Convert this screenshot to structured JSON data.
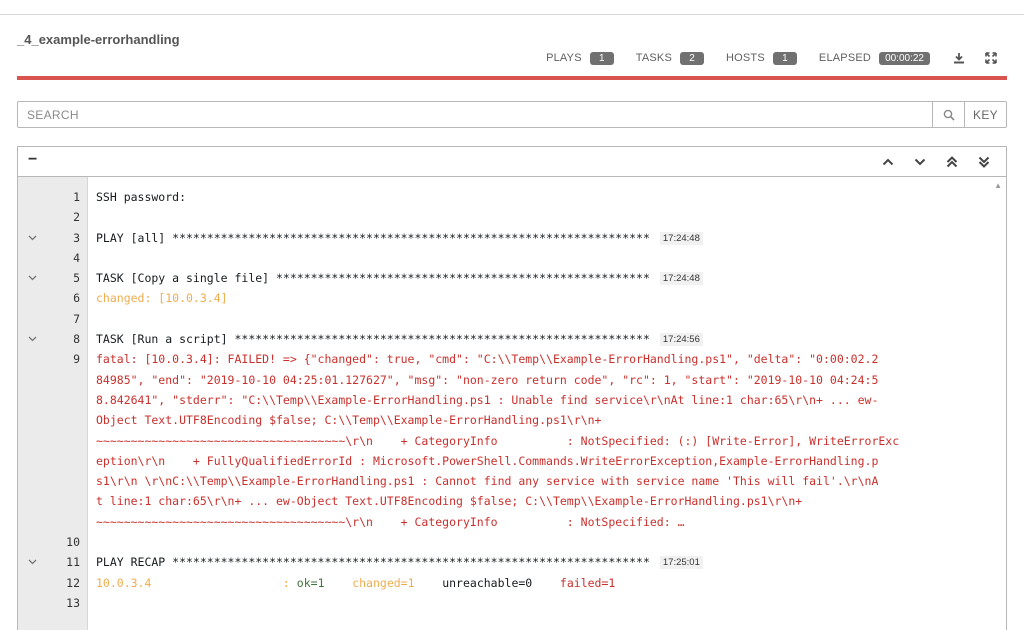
{
  "job": {
    "title": "_4_example-errorhandling"
  },
  "stats": [
    {
      "label": "PLAYS",
      "value": "1"
    },
    {
      "label": "TASKS",
      "value": "2"
    },
    {
      "label": "HOSTS",
      "value": "1"
    },
    {
      "label": "ELAPSED",
      "value": "00:00:22"
    }
  ],
  "icons": {
    "download": "download-icon",
    "expand": "fullscreen-icon",
    "search": "search-icon"
  },
  "colors": {
    "status_bar": "#d9534f",
    "changed": "#f0ad4e",
    "failed": "#c9302c",
    "ok": "#3c763d"
  },
  "search": {
    "placeholder": "SEARCH",
    "key_label": "KEY"
  },
  "output": {
    "collapse_label": "−",
    "lines": [
      {
        "num": "1",
        "toggle": false,
        "segments": [
          {
            "text": "SSH password:",
            "cls": "c-default"
          }
        ]
      },
      {
        "num": "2",
        "toggle": false,
        "segments": []
      },
      {
        "num": "3",
        "toggle": true,
        "segments": [
          {
            "text": "PLAY [all] *********************************************************************",
            "cls": "c-default"
          }
        ],
        "time": "17:24:48"
      },
      {
        "num": "4",
        "toggle": false,
        "segments": []
      },
      {
        "num": "5",
        "toggle": true,
        "segments": [
          {
            "text": "TASK [Copy a single file] ******************************************************",
            "cls": "c-default"
          }
        ],
        "time": "17:24:48"
      },
      {
        "num": "6",
        "toggle": false,
        "segments": [
          {
            "text": "changed: [10.0.3.4]",
            "cls": "c-changed"
          }
        ]
      },
      {
        "num": "7",
        "toggle": false,
        "segments": []
      },
      {
        "num": "8",
        "toggle": true,
        "segments": [
          {
            "text": "TASK [Run a script] ************************************************************",
            "cls": "c-default"
          }
        ],
        "time": "17:24:56"
      },
      {
        "num": "9",
        "toggle": false,
        "segments": [
          {
            "text": "fatal: [10.0.3.4]: FAILED! => {\"changed\": true, \"cmd\": \"C:\\\\Temp\\\\Example-ErrorHandling.ps1\", \"delta\": \"0:00:02.2",
            "cls": "c-failed"
          }
        ]
      },
      {
        "num": "",
        "toggle": false,
        "segments": [
          {
            "text": "84985\", \"end\": \"2019-10-10 04:25:01.127627\", \"msg\": \"non-zero return code\", \"rc\": 1, \"start\": \"2019-10-10 04:24:5",
            "cls": "c-failed"
          }
        ]
      },
      {
        "num": "",
        "toggle": false,
        "segments": [
          {
            "text": "8.842641\", \"stderr\": \"C:\\\\Temp\\\\Example-ErrorHandling.ps1 : Unable find service\\r\\nAt line:1 char:65\\r\\n+ ... ew-",
            "cls": "c-failed"
          }
        ]
      },
      {
        "num": "",
        "toggle": false,
        "segments": [
          {
            "text": "Object Text.UTF8Encoding $false; C:\\\\Temp\\\\Example-ErrorHandling.ps1\\r\\n+",
            "cls": "c-failed"
          }
        ]
      },
      {
        "num": "",
        "toggle": false,
        "segments": [
          {
            "text": "~~~~~~~~~~~~~~~~~~~~~~~~~~~~~~~~~~~~\\r\\n    + CategoryInfo          : NotSpecified: (:) [Write-Error], WriteErrorExc",
            "cls": "c-failed"
          }
        ]
      },
      {
        "num": "",
        "toggle": false,
        "segments": [
          {
            "text": "eption\\r\\n    + FullyQualifiedErrorId : Microsoft.PowerShell.Commands.WriteErrorException,Example-ErrorHandling.p",
            "cls": "c-failed"
          }
        ]
      },
      {
        "num": "",
        "toggle": false,
        "segments": [
          {
            "text": "s1\\r\\n \\r\\nC:\\\\Temp\\\\Example-ErrorHandling.ps1 : Cannot find any service with service name 'This will fail'.\\r\\nA",
            "cls": "c-failed"
          }
        ]
      },
      {
        "num": "",
        "toggle": false,
        "segments": [
          {
            "text": "t line:1 char:65\\r\\n+ ... ew-Object Text.UTF8Encoding $false; C:\\\\Temp\\\\Example-ErrorHandling.ps1\\r\\n+",
            "cls": "c-failed"
          }
        ]
      },
      {
        "num": "",
        "toggle": false,
        "segments": [
          {
            "text": "~~~~~~~~~~~~~~~~~~~~~~~~~~~~~~~~~~~~\\r\\n    + CategoryInfo          : NotSpecified: …",
            "cls": "c-failed"
          }
        ]
      },
      {
        "num": "10",
        "toggle": false,
        "segments": []
      },
      {
        "num": "11",
        "toggle": true,
        "segments": [
          {
            "text": "PLAY RECAP *********************************************************************",
            "cls": "c-default"
          }
        ],
        "time": "17:25:01"
      },
      {
        "num": "12",
        "toggle": false,
        "segments": [
          {
            "text": "10.0.3.4                   : ",
            "cls": "c-changed"
          },
          {
            "text": "ok=1",
            "cls": "c-ok"
          },
          {
            "text": "    ",
            "cls": "c-default"
          },
          {
            "text": "changed=1",
            "cls": "c-changed"
          },
          {
            "text": "    unreachable=0    ",
            "cls": "c-default"
          },
          {
            "text": "failed=1",
            "cls": "c-failed"
          }
        ]
      },
      {
        "num": "13",
        "toggle": false,
        "segments": []
      }
    ]
  }
}
